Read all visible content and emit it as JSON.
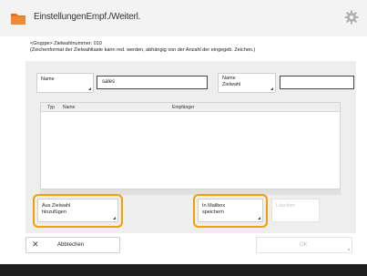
{
  "header": {
    "title": "EinstellungenEmpf./Weiterl.",
    "app_icon": "folder-icon",
    "settings_icon": "gear-icon"
  },
  "info": {
    "line1": "<Gruppe> Zielwahlnummer: 010",
    "line2": "(Zeichenformat der Zielwahltaste kann red. werden, abhängig von der Anzahl der eingegeb. Zeichen.)"
  },
  "form": {
    "name_button": "Name",
    "name_value": "sales",
    "zielwahl_name_button_line1": "Name",
    "zielwahl_name_button_line2": "Zielwahl",
    "zielwahl_name_value": ""
  },
  "list": {
    "columns": [
      "Typ",
      "Name",
      "Empfänger"
    ],
    "rows": []
  },
  "actions": {
    "add_from_zielwahl_line1": "Aus Zielwahl",
    "add_from_zielwahl_line2": "hinzufügen",
    "save_mailbox_line1": "In Mailbox",
    "save_mailbox_line2": "speichern",
    "delete": "Löschen"
  },
  "footer": {
    "cancel": "Abbrechen",
    "ok": "OK"
  },
  "colors": {
    "highlight": "#f2a000",
    "accent": "#e8701a"
  }
}
